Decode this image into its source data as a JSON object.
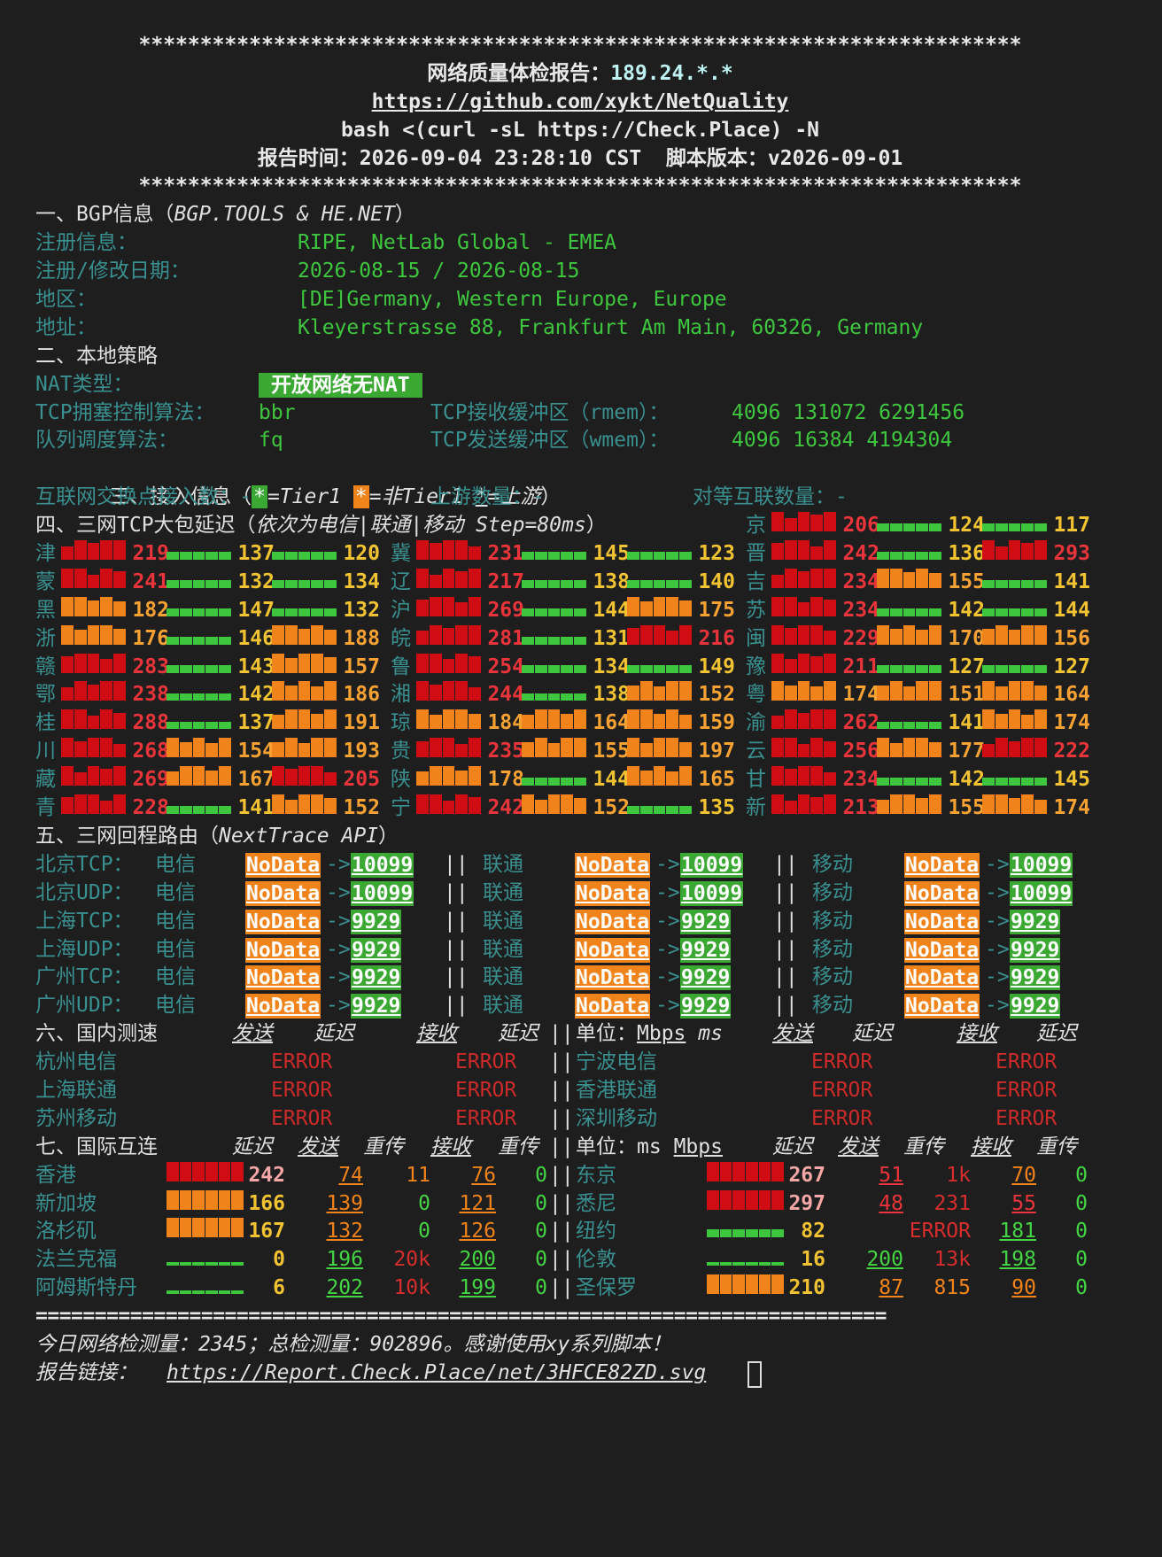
{
  "header": {
    "stars": "************************************************************************",
    "title_prefix": "网络质量体检报告：",
    "title_ip": "189.24.*.*",
    "repo_url": "https://github.com/xykt/NetQuality",
    "command": "bash <(curl -sL https://Check.Place) -N",
    "report_time": "报告时间：2026-09-04 23:28:10 CST  脚本版本：v2026-09-01"
  },
  "bgp": {
    "section": "一、BGP信息（",
    "section_src": "BGP.TOOLS & HE.NET",
    "section_end": "）",
    "rows": [
      {
        "label": "注册信息：",
        "value": "RIPE, NetLab Global - EMEA"
      },
      {
        "label": "注册/修改日期：",
        "value": "2026-08-15 / 2026-08-15"
      },
      {
        "label": "地区：",
        "value": "[DE]Germany, Western Europe, Europe"
      },
      {
        "label": "地址：",
        "value": "Kleyerstrasse 88, Frankfurt Am Main, 60326, Germany"
      }
    ]
  },
  "local": {
    "section": "二、本地策略",
    "nat_label": "NAT类型：",
    "nat_value": "开放网络无NAT",
    "tcp_cc_label": "TCP拥塞控制算法：",
    "tcp_cc_value": "bbr",
    "rmem_label": "TCP接收缓冲区（rmem）：",
    "rmem_value": "4096 131072 6291456",
    "qdisc_label": "队列调度算法：",
    "qdisc_value": "fq",
    "wmem_label": "TCP发送缓冲区（wmem）：",
    "wmem_value": "4096 16384 4194304"
  },
  "access": {
    "section": "三、接入信息（",
    "legend_tier1": "=Tier1 ",
    "legend_non": "=非Tier1 ",
    "legend_up": "=上游",
    "legend_end": "）",
    "star": "*",
    "ix_label": "互联网交换点接入数：",
    "ix_value": "-",
    "up_label": "上游数量：",
    "up_value": "-",
    "peer_label": "对等互联数量：",
    "peer_value": "-"
  },
  "latency": {
    "section": "四、三网TCP大包延迟（",
    "section_sub": "依次为电信|联通|移动 Step=80ms",
    "section_end": "）",
    "colors": {
      "green": "#3fc63f",
      "orange": "#f0831a",
      "red": "#d10d14"
    },
    "regions": [
      {
        "name": "京",
        "vals": [
          206,
          124,
          117
        ]
      },
      {
        "name": "津",
        "vals": [
          219,
          137,
          120
        ]
      },
      {
        "name": "冀",
        "vals": [
          231,
          145,
          123
        ]
      },
      {
        "name": "晋",
        "vals": [
          242,
          136,
          293
        ]
      },
      {
        "name": "蒙",
        "vals": [
          241,
          132,
          134
        ]
      },
      {
        "name": "辽",
        "vals": [
          217,
          138,
          140
        ]
      },
      {
        "name": "吉",
        "vals": [
          234,
          155,
          141
        ]
      },
      {
        "name": "黑",
        "vals": [
          182,
          147,
          132
        ]
      },
      {
        "name": "沪",
        "vals": [
          269,
          144,
          175
        ]
      },
      {
        "name": "苏",
        "vals": [
          234,
          142,
          144
        ]
      },
      {
        "name": "浙",
        "vals": [
          176,
          146,
          188
        ]
      },
      {
        "name": "皖",
        "vals": [
          281,
          131,
          216
        ]
      },
      {
        "name": "闽",
        "vals": [
          229,
          170,
          156
        ]
      },
      {
        "name": "赣",
        "vals": [
          283,
          143,
          157
        ]
      },
      {
        "name": "鲁",
        "vals": [
          254,
          134,
          149
        ]
      },
      {
        "name": "豫",
        "vals": [
          211,
          127,
          127
        ]
      },
      {
        "name": "鄂",
        "vals": [
          238,
          142,
          186
        ]
      },
      {
        "name": "湘",
        "vals": [
          244,
          138,
          152
        ]
      },
      {
        "name": "粤",
        "vals": [
          174,
          151,
          164
        ]
      },
      {
        "name": "桂",
        "vals": [
          288,
          137,
          191
        ]
      },
      {
        "name": "琼",
        "vals": [
          184,
          164,
          159
        ]
      },
      {
        "name": "渝",
        "vals": [
          262,
          141,
          174
        ]
      },
      {
        "name": "川",
        "vals": [
          268,
          154,
          193
        ]
      },
      {
        "name": "贵",
        "vals": [
          235,
          155,
          197
        ]
      },
      {
        "name": "云",
        "vals": [
          256,
          177,
          222
        ]
      },
      {
        "name": "藏",
        "vals": [
          269,
          167,
          205
        ]
      },
      {
        "name": "陕",
        "vals": [
          178,
          144,
          165
        ]
      },
      {
        "name": "甘",
        "vals": [
          234,
          142,
          145
        ]
      },
      {
        "name": "青",
        "vals": [
          228,
          141,
          152
        ]
      },
      {
        "name": "宁",
        "vals": [
          242,
          152,
          135
        ]
      },
      {
        "name": "新",
        "vals": [
          213,
          155,
          174
        ]
      }
    ]
  },
  "routes": {
    "section": "五、三网回程路由（",
    "section_src": "NextTrace API",
    "section_end": "）",
    "isp": [
      "电信",
      "联通",
      "移动"
    ],
    "nodata": "NoData",
    "arrow": "->",
    "sep": "||",
    "rows": [
      {
        "label": "北京TCP：",
        "as": [
          "10099",
          "10099",
          "10099"
        ]
      },
      {
        "label": "北京UDP：",
        "as": [
          "10099",
          "10099",
          "10099"
        ]
      },
      {
        "label": "上海TCP：",
        "as": [
          "9929",
          "9929",
          "9929"
        ]
      },
      {
        "label": "上海UDP：",
        "as": [
          "9929",
          "9929",
          "9929"
        ]
      },
      {
        "label": "广州TCP：",
        "as": [
          "9929",
          "9929",
          "9929"
        ]
      },
      {
        "label": "广州UDP：",
        "as": [
          "9929",
          "9929",
          "9929"
        ]
      }
    ]
  },
  "domestic": {
    "section": "六、国内测速",
    "send": "发送",
    "lat": "延迟",
    "recv": "接收",
    "unit_label": "单位：",
    "unit_mbps": "Mbps",
    "unit_ms": "ms",
    "sep": "||",
    "error": "ERROR",
    "left": [
      "杭州电信",
      "上海联通",
      "苏州移动"
    ],
    "right": [
      "宁波电信",
      "香港联通",
      "深圳移动"
    ]
  },
  "intl": {
    "section": "七、国际互连",
    "lat": "延迟",
    "send": "发送",
    "retr": "重传",
    "recv": "接收",
    "unit_label": "单位：",
    "unit_ms": "ms",
    "unit_mbps": "Mbps",
    "sep": "||",
    "left": [
      {
        "name": "香港",
        "lat": "242",
        "color": "red",
        "send": "74",
        "sretr": "11",
        "recv": "76",
        "rretr": "0"
      },
      {
        "name": "新加坡",
        "lat": "166",
        "color": "orange",
        "send": "139",
        "sretr": "0",
        "recv": "121",
        "rretr": "0"
      },
      {
        "name": "洛杉矶",
        "lat": "167",
        "color": "orange",
        "send": "132",
        "sretr": "0",
        "recv": "126",
        "rretr": "0"
      },
      {
        "name": "法兰克福",
        "lat": "0",
        "color": "green",
        "send": "196",
        "sretr": "20k",
        "recv": "200",
        "rretr": "0"
      },
      {
        "name": "阿姆斯特丹",
        "lat": "6",
        "color": "green",
        "send": "202",
        "sretr": "10k",
        "recv": "199",
        "rretr": "0"
      }
    ],
    "right": [
      {
        "name": "东京",
        "lat": "267",
        "color": "red",
        "send": "51",
        "sretr": "1k",
        "recv": "70",
        "rretr": "0"
      },
      {
        "name": "悉尼",
        "lat": "297",
        "color": "red",
        "send": "48",
        "sretr": "231",
        "recv": "55",
        "rretr": "0"
      },
      {
        "name": "纽约",
        "lat": "82",
        "color": "green",
        "send": "",
        "sretr": "ERROR",
        "recv": "181",
        "rretr": "0"
      },
      {
        "name": "伦敦",
        "lat": "16",
        "color": "green",
        "send": "200",
        "sretr": "13k",
        "recv": "198",
        "rretr": "0"
      },
      {
        "name": "圣保罗",
        "lat": "210",
        "color": "orange",
        "send": "87",
        "sretr": "815",
        "recv": "90",
        "rretr": "0"
      }
    ]
  },
  "footer": {
    "equals": "========================================================================",
    "stats": "今日网络检测量：2345；总检测量：902896。感谢使用xy系列脚本！",
    "link_label": "报告链接：",
    "link": "https://Report.Check.Place/net/3HFCE82ZD.svg"
  }
}
